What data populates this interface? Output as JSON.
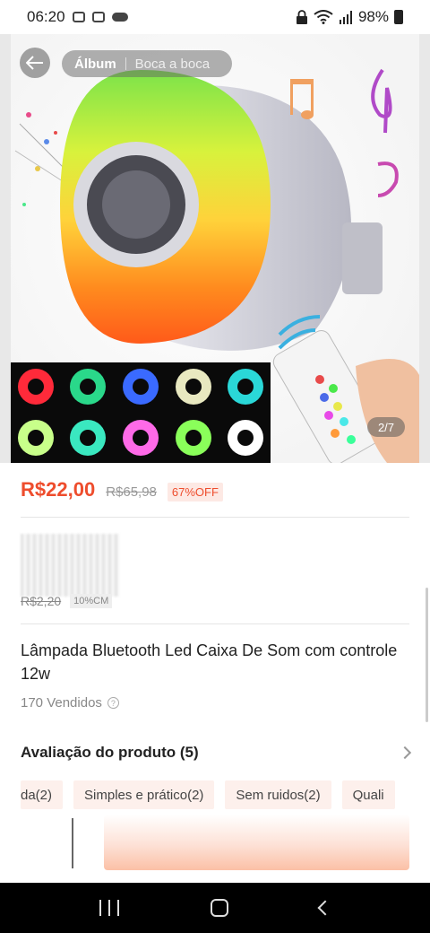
{
  "status_bar": {
    "time": "06:20",
    "battery": "98%"
  },
  "hero": {
    "album_label": "Álbum",
    "boca_label": "Boca a boca",
    "counter": "2/7"
  },
  "price": {
    "current": "R$22,00",
    "original": "R$65,98",
    "discount": "67%OFF"
  },
  "installment": {
    "price": "R$2,20",
    "tag": "10%CM"
  },
  "product": {
    "title": "Lâmpada Bluetooth Led Caixa De Som com controle 12w",
    "sold": "170 Vendidos"
  },
  "reviews": {
    "title": "Avaliação do produto (5)",
    "tags": [
      "da(2)",
      "Simples e prático(2)",
      "Sem ruidos(2)",
      "Quali"
    ]
  },
  "colors": {
    "accent": "#ee4d2d",
    "tag_bg": "#fdf0ec"
  }
}
